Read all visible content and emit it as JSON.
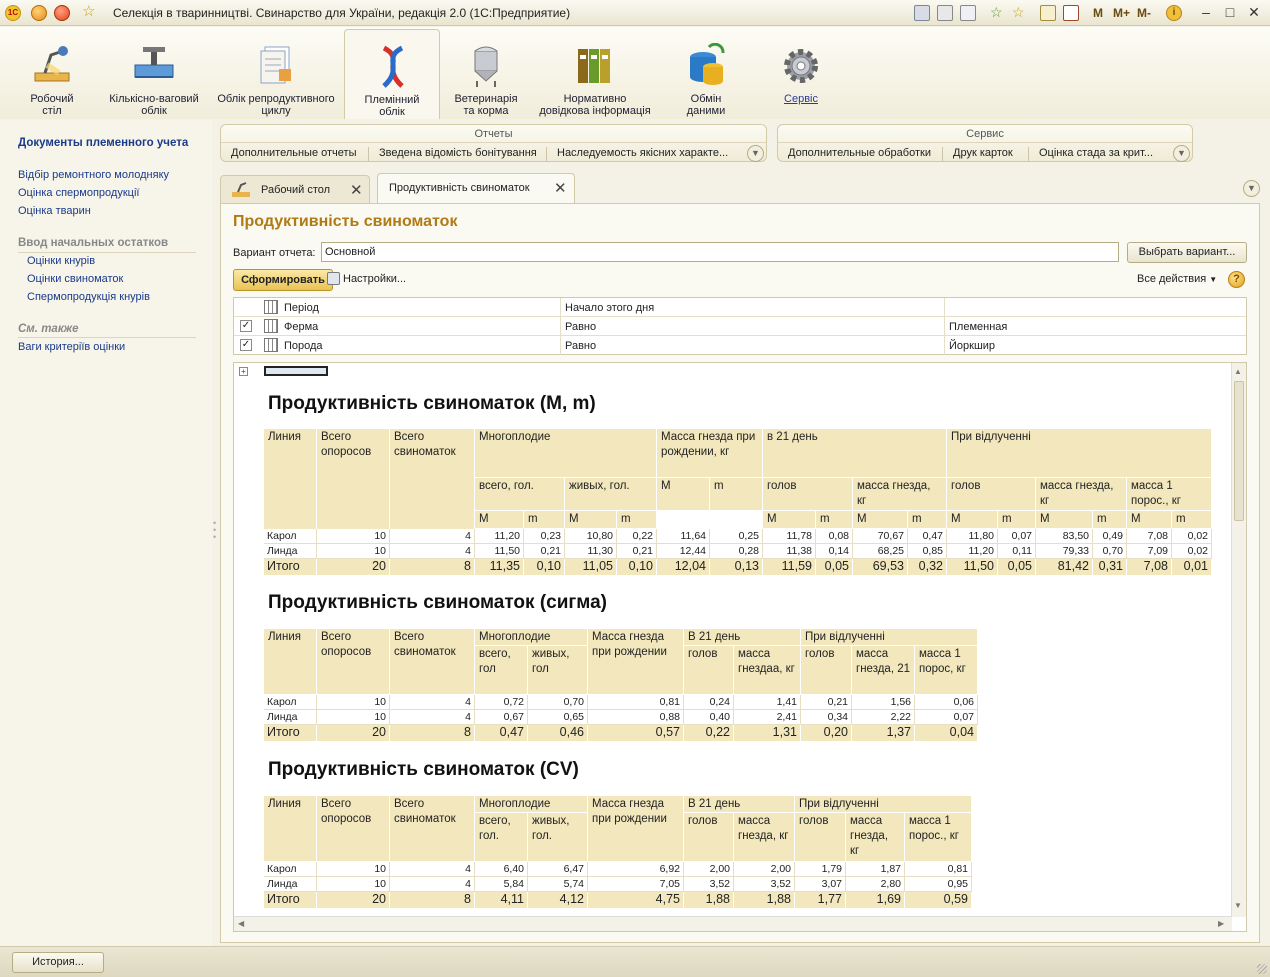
{
  "window": {
    "logo": "1С",
    "title": "Селекція в тваринництві. Свинарство для України, редакція 2.0  (1С:Предприятие)",
    "mem_buttons": [
      "M",
      "M+",
      "M-"
    ]
  },
  "sections": [
    {
      "label": "Робочий\nстіл",
      "icon": "desk-lamp-icon"
    },
    {
      "label": "Кількісно-ваговий\nоблік",
      "icon": "scales-icon"
    },
    {
      "label": "Облік репродуктивного\nциклу",
      "icon": "documents-icon"
    },
    {
      "label": "Племінний\nоблік",
      "icon": "dna-icon"
    },
    {
      "label": "Ветеринарія\nта корма",
      "icon": "silo-icon"
    },
    {
      "label": "Нормативно\nдовідкова інформація",
      "icon": "binders-icon"
    },
    {
      "label": "Обмін\nданими",
      "icon": "database-exchange-icon"
    },
    {
      "label": "Сервіс",
      "icon": "gear-icon"
    }
  ],
  "left_panel": {
    "title": "Документы племенного учета",
    "links": [
      "Відбір ремонтного молодняку",
      "Оцінка спермопродукції",
      "Оцінка тварин"
    ],
    "group_initial": "Ввод начальных остатков",
    "group_initial_links": [
      "Оцінки кнурів",
      "Оцінки свиноматок",
      "Спермопродукція кнурів"
    ],
    "group_see_also": "См. также",
    "see_also_links": [
      "Ваги критеріїв оцінки"
    ]
  },
  "command_bars": {
    "reports": {
      "caption": "Отчеты",
      "commands": [
        "Дополнительные отчеты",
        "Зведена відомість бонітування",
        "Наследуемость якісних характе..."
      ]
    },
    "service": {
      "caption": "Сервис",
      "commands": [
        "Дополнительные обработки",
        "Друк карток",
        "Оцінка стада за крит..."
      ]
    }
  },
  "tabs": [
    "Рабочий стол",
    "Продуктивність свиноматок"
  ],
  "form": {
    "title": "Продуктивність свиноматок",
    "variant_label": "Вариант отчета:",
    "variant_value": "Основной",
    "choose_variant": "Выбрать вариант...",
    "generate": "Сформировать",
    "settings": "Настройки...",
    "all_actions": "Все действия",
    "help": "?"
  },
  "filters": [
    {
      "checked": false,
      "name": "Період",
      "condition": "Начало этого дня",
      "value": ""
    },
    {
      "checked": true,
      "name": "Ферма",
      "condition": "Равно",
      "value": "Племенная"
    },
    {
      "checked": true,
      "name": "Порода",
      "condition": "Равно",
      "value": "Йоркшир"
    }
  ],
  "report": {
    "table1": {
      "title": "Продуктивність свиноматок (M, m)",
      "headers": {
        "line": "Линия",
        "farrowings": "Всего опоросов",
        "sows": "Всего свиноматок",
        "prolific": "Многоплодие",
        "prolific_total": "всего, гол.",
        "prolific_alive": "живых, гол.",
        "nest_birth": "Масса гнезда при рождении, кг",
        "day21": "в 21 день",
        "day21_heads": "голов",
        "day21_nest": "масса гнезда, кг",
        "weaning": "При відлученні",
        "weaning_heads": "голов",
        "weaning_nest": "масса гнезда, кг",
        "weaning_piglet": "масса 1 порос., кг",
        "M": "М",
        "m": "m"
      },
      "rows": [
        [
          "Карол",
          "10",
          "4",
          "11,20",
          "0,23",
          "10,80",
          "0,22",
          "11,64",
          "0,25",
          "11,78",
          "0,08",
          "70,67",
          "0,47",
          "11,80",
          "0,07",
          "83,50",
          "0,49",
          "7,08",
          "0,02"
        ],
        [
          "Линда",
          "10",
          "4",
          "11,50",
          "0,21",
          "11,30",
          "0,21",
          "12,44",
          "0,28",
          "11,38",
          "0,14",
          "68,25",
          "0,85",
          "11,20",
          "0,11",
          "79,33",
          "0,70",
          "7,09",
          "0,02"
        ]
      ],
      "total": [
        "Итого",
        "20",
        "8",
        "11,35",
        "0,10",
        "11,05",
        "0,10",
        "12,04",
        "0,13",
        "11,59",
        "0,05",
        "69,53",
        "0,32",
        "11,50",
        "0,05",
        "81,42",
        "0,31",
        "7,08",
        "0,01"
      ]
    },
    "table2": {
      "title": "Продуктивність свиноматок (сигма)",
      "headers": [
        "Линия",
        "Всего опоросов",
        "Всего свиноматок",
        "Многоплодие",
        "Масса гнезда при рождении",
        "В 21 день",
        "При відлученні",
        "всего, гол",
        "живых, гол",
        "голов",
        "масса гнездаа, кг",
        "голов",
        "масса гнезда, 21",
        "масса 1 порос, кг"
      ],
      "rows": [
        [
          "Карол",
          "10",
          "4",
          "0,72",
          "0,70",
          "0,81",
          "0,24",
          "1,41",
          "0,21",
          "1,56",
          "0,06"
        ],
        [
          "Линда",
          "10",
          "4",
          "0,67",
          "0,65",
          "0,88",
          "0,40",
          "2,41",
          "0,34",
          "2,22",
          "0,07"
        ]
      ],
      "total": [
        "Итого",
        "20",
        "8",
        "0,47",
        "0,46",
        "0,57",
        "0,22",
        "1,31",
        "0,20",
        "1,37",
        "0,04"
      ]
    },
    "table3": {
      "title": "Продуктивність свиноматок (CV)",
      "headers": [
        "Линия",
        "Всего опоросов",
        "Всего свиноматок",
        "Многоплодие",
        "Масса гнезда при рождении",
        "В 21 день",
        "При відлученні",
        "всего, гол.",
        "живых, гол.",
        "голов",
        "масса гнезда, кг",
        "голов",
        "масса гнезда, кг",
        "масса 1 порос., кг"
      ],
      "rows": [
        [
          "Карол",
          "10",
          "4",
          "6,40",
          "6,47",
          "6,92",
          "2,00",
          "2,00",
          "1,79",
          "1,87",
          "0,81"
        ],
        [
          "Линда",
          "10",
          "4",
          "5,84",
          "5,74",
          "7,05",
          "3,52",
          "3,52",
          "3,07",
          "2,80",
          "0,95"
        ]
      ],
      "total": [
        "Итого",
        "20",
        "8",
        "4,11",
        "4,12",
        "4,75",
        "1,88",
        "1,88",
        "1,77",
        "1,69",
        "0,59"
      ]
    }
  },
  "bottom": {
    "history": "История..."
  }
}
